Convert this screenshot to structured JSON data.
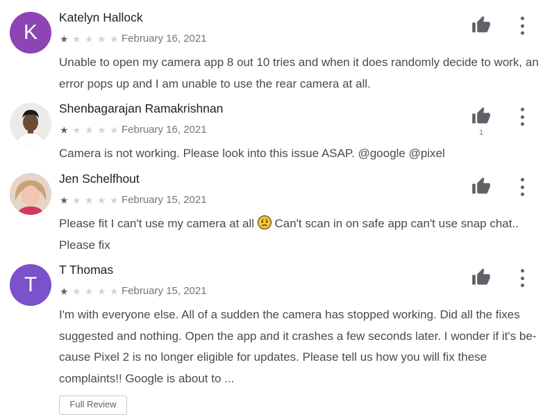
{
  "reviews": [
    {
      "avatar_letter": "K",
      "name": "Katelyn Hallock",
      "rating": 1,
      "date": "February 16, 2021",
      "body": "Unable to open my camera app 8 out 10 tries and when it does randomly decide to work, an error pops up and I am unable to use the rear camera at all.",
      "helpful_count": ""
    },
    {
      "avatar_letter": "",
      "name": "Shenbagarajan Ramakrishnan",
      "rating": 1,
      "date": "February 16, 2021",
      "body": "Camera is not working. Please look into this issue ASAP. @google @pixel",
      "helpful_count": "1"
    },
    {
      "avatar_letter": "",
      "name": "Jen Schelfhout",
      "rating": 1,
      "date": "February 15, 2021",
      "body_before": "Please fit I can't use my camera at all ",
      "body_after": " Can't scan in on safe app can't use snap chat.. Please fix",
      "helpful_count": ""
    },
    {
      "avatar_letter": "T",
      "name": "T Thomas",
      "rating": 1,
      "date": "February 15, 2021",
      "body": "I'm with everyone else. All of a sudden the camera has stopped working. Did all the fixes suggested and nothing. Open the app and it crashes a few seconds later. I wonder if it's be-cause Pixel 2 is no longer eligible for updates. Please tell us how you will fix these complaints!! Google is about to ...",
      "helpful_count": ""
    }
  ],
  "full_review_label": "Full Review",
  "star_glyph": "★",
  "icons": {
    "helpful": "thumbs-up-icon",
    "more": "more-vert-icon",
    "emoji": "worried-face-emoji"
  },
  "colors": {
    "avatar_k": "#8e44b5",
    "avatar_t": "#7b52c9",
    "star_on": "#616161",
    "star_off": "#d3d3d3"
  }
}
